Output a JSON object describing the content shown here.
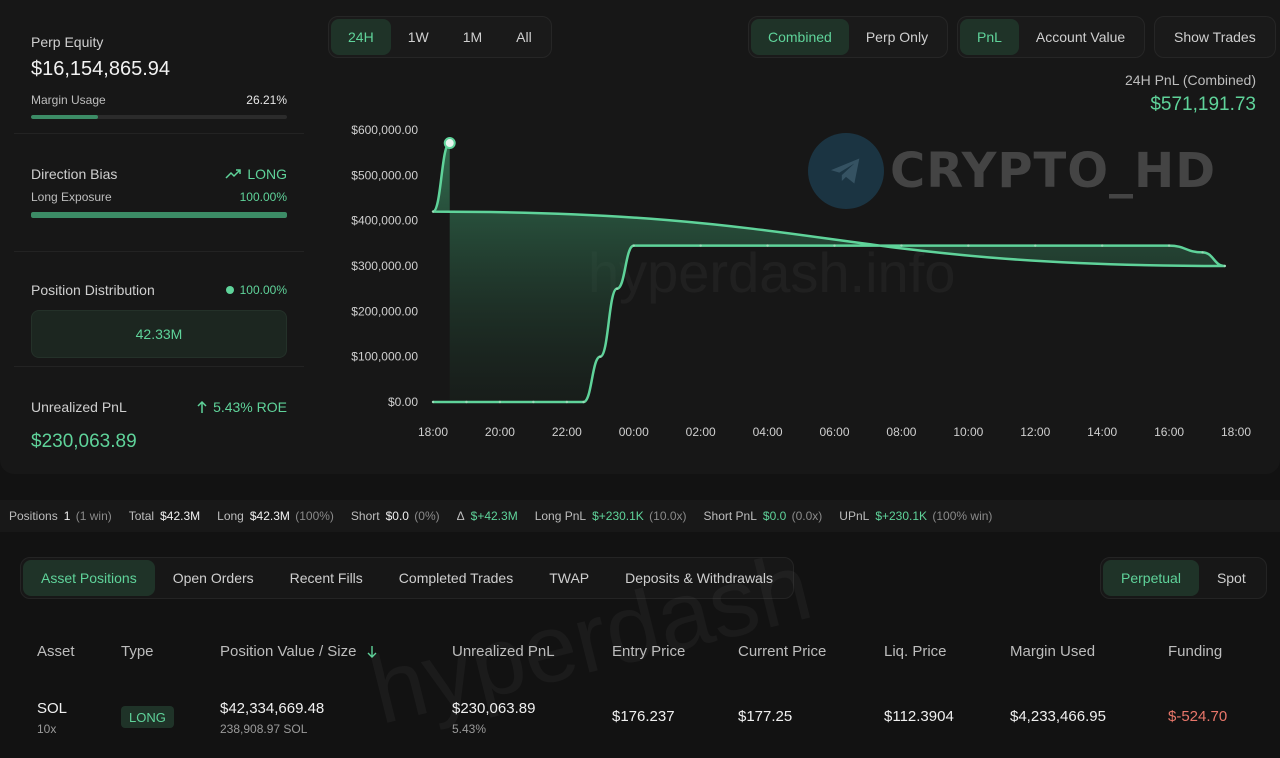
{
  "left": {
    "equity": {
      "label": "Perp Equity",
      "value": "$16,154,865.94",
      "margin_label": "Margin Usage",
      "margin_value": "26.21%",
      "margin_fraction": 0.2621
    },
    "bias": {
      "label": "Direction Bias",
      "value": "LONG",
      "icon": "trend-up-icon",
      "exposure_label": "Long Exposure",
      "exposure_value": "100.00%",
      "exposure_fraction": 1.0
    },
    "distribution": {
      "label": "Position Distribution",
      "value": "100.00%",
      "box_value": "42.33M"
    },
    "upnl": {
      "label": "Unrealized PnL",
      "roe": "5.43% ROE",
      "value": "$230,063.89"
    }
  },
  "ranges": [
    {
      "label": "24H",
      "active": true
    },
    {
      "label": "1W",
      "active": false
    },
    {
      "label": "1M",
      "active": false
    },
    {
      "label": "All",
      "active": false
    }
  ],
  "mode": [
    {
      "label": "Combined",
      "active": true
    },
    {
      "label": "Perp Only",
      "active": false
    }
  ],
  "metric": [
    {
      "label": "PnL",
      "active": true
    },
    {
      "label": "Account Value",
      "active": false
    }
  ],
  "show_trades": "Show Trades",
  "chart_header": {
    "title": "24H PnL (Combined)",
    "value": "$571,191.73"
  },
  "watermarks": {
    "brand": "CRYPTO_HD",
    "site": "hyperdash.info",
    "faint": "hyperdash"
  },
  "chart_data": {
    "type": "area",
    "x": [
      "18:00",
      "19:00",
      "20:00",
      "21:00",
      "22:00",
      "22:30",
      "23:00",
      "23:30",
      "00:00",
      "02:00",
      "04:00",
      "06:00",
      "08:00",
      "10:00",
      "12:00",
      "14:00",
      "16:00",
      "17:00",
      "17:40",
      "18:00",
      "18:30"
    ],
    "values": [
      0,
      0,
      0,
      0,
      0,
      0,
      100000,
      250000,
      345000,
      345000,
      345000,
      345000,
      345000,
      345000,
      345000,
      345000,
      345000,
      330000,
      300000,
      420000,
      571191.73
    ],
    "xticks": [
      "18:00",
      "20:00",
      "22:00",
      "00:00",
      "02:00",
      "04:00",
      "06:00",
      "08:00",
      "10:00",
      "12:00",
      "14:00",
      "16:00",
      "18:00"
    ],
    "yticks": [
      "$0.00",
      "$100,000.00",
      "$200,000.00",
      "$300,000.00",
      "$400,000.00",
      "$500,000.00",
      "$600,000.00"
    ],
    "ylim": [
      0,
      600000
    ],
    "line_color": "#5fd39a",
    "grid": false
  },
  "summary": {
    "positions_label": "Positions",
    "positions_value": "1",
    "positions_note": "(1 win)",
    "total_label": "Total",
    "total_value": "$42.3M",
    "long_label": "Long",
    "long_value": "$42.3M",
    "long_note": "(100%)",
    "short_label": "Short",
    "short_value": "$0.0",
    "short_note": "(0%)",
    "delta_label": "Δ",
    "delta_value": "$+42.3M",
    "longpnl_label": "Long PnL",
    "longpnl_value": "$+230.1K",
    "longpnl_note": "(10.0x)",
    "shortpnl_label": "Short PnL",
    "shortpnl_value": "$0.0",
    "shortpnl_note": "(0.0x)",
    "upnl_label": "UPnL",
    "upnl_value": "$+230.1K",
    "upnl_note": "(100% win)"
  },
  "tabs": [
    {
      "label": "Asset Positions",
      "active": true
    },
    {
      "label": "Open Orders",
      "active": false
    },
    {
      "label": "Recent Fills",
      "active": false
    },
    {
      "label": "Completed Trades",
      "active": false
    },
    {
      "label": "TWAP",
      "active": false
    },
    {
      "label": "Deposits & Withdrawals",
      "active": false
    }
  ],
  "market_tabs": [
    {
      "label": "Perpetual",
      "active": true
    },
    {
      "label": "Spot",
      "active": false
    }
  ],
  "table": {
    "headers": [
      "Asset",
      "Type",
      "Position Value / Size",
      "Unrealized PnL",
      "Entry Price",
      "Current Price",
      "Liq. Price",
      "Margin Used",
      "Funding"
    ],
    "sort_icon": "arrow-down-icon",
    "row": {
      "asset": "SOL",
      "leverage": "10x",
      "type": "LONG",
      "position_value": "$42,334,669.48",
      "position_size": "238,908.97 SOL",
      "upnl": "$230,063.89",
      "upnl_pct": "5.43%",
      "entry": "$176.237",
      "current": "$177.25",
      "liq": "$112.3904",
      "margin": "$4,233,466.95",
      "funding": "$-524.70"
    }
  }
}
